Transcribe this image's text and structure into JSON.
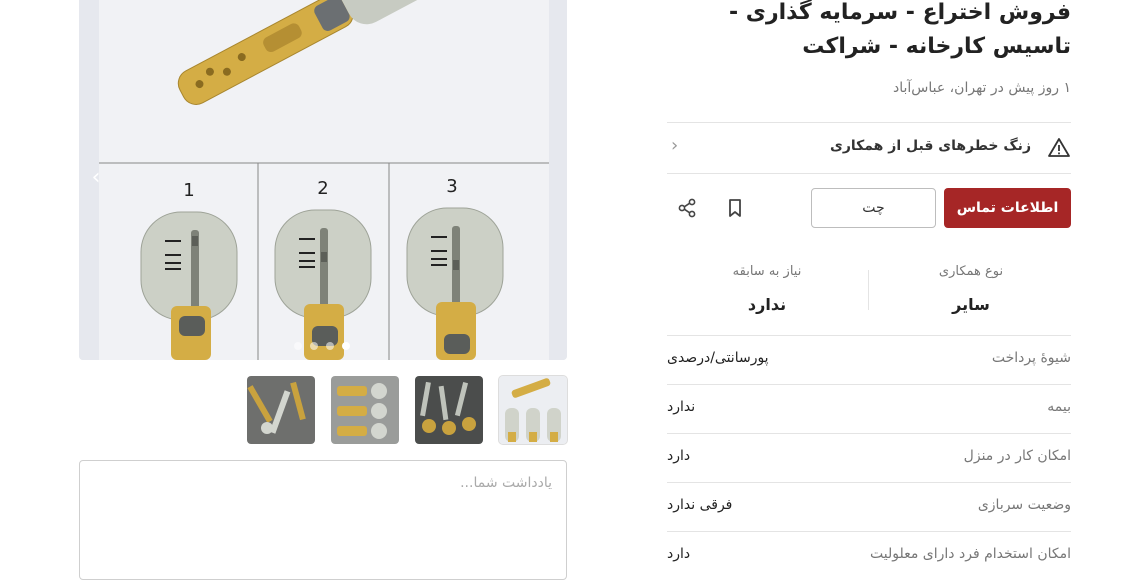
{
  "gallery": {
    "prev_arrow": "‹",
    "slide_count": 4,
    "active_slide": 4,
    "panel_numbers": [
      "1",
      "2",
      "3"
    ],
    "thumbnails": [
      "thumb-1",
      "thumb-2",
      "thumb-3",
      "thumb-4"
    ]
  },
  "note": {
    "placeholder": "یادداشت شما..."
  },
  "ad": {
    "title": "فروش اختراع - سرمایه گذاری - تاسیس کارخانه - شراکت",
    "posted": "۱ روز پیش در تهران، عباس‌آباد"
  },
  "warning": {
    "text": "زنگ خطرهای قبل از همکاری",
    "icon": "warning-triangle-icon"
  },
  "actions": {
    "contact_label": "اطلاعات تماس",
    "chat_label": "چت",
    "bookmark_icon": "bookmark-icon",
    "share_icon": "share-icon"
  },
  "stats": [
    {
      "label": "نوع همکاری",
      "value": "سایر"
    },
    {
      "label": "نیاز به سابقه",
      "value": "ندارد"
    }
  ],
  "details": [
    {
      "key": "شیوهٔ پرداخت",
      "value": "پورسانتی/درصدی"
    },
    {
      "key": "بیمه",
      "value": "ندارد"
    },
    {
      "key": "امکان کار در منزل",
      "value": "دارد"
    },
    {
      "key": "وضعیت سربازی",
      "value": "فرقی ندارد"
    },
    {
      "key": "امکان استخدام فرد دارای معلولیت",
      "value": "دارد"
    }
  ],
  "colors": {
    "primary": "#a62626",
    "key_brass": "#d8b24a",
    "key_silver": "#c9cdc4"
  }
}
